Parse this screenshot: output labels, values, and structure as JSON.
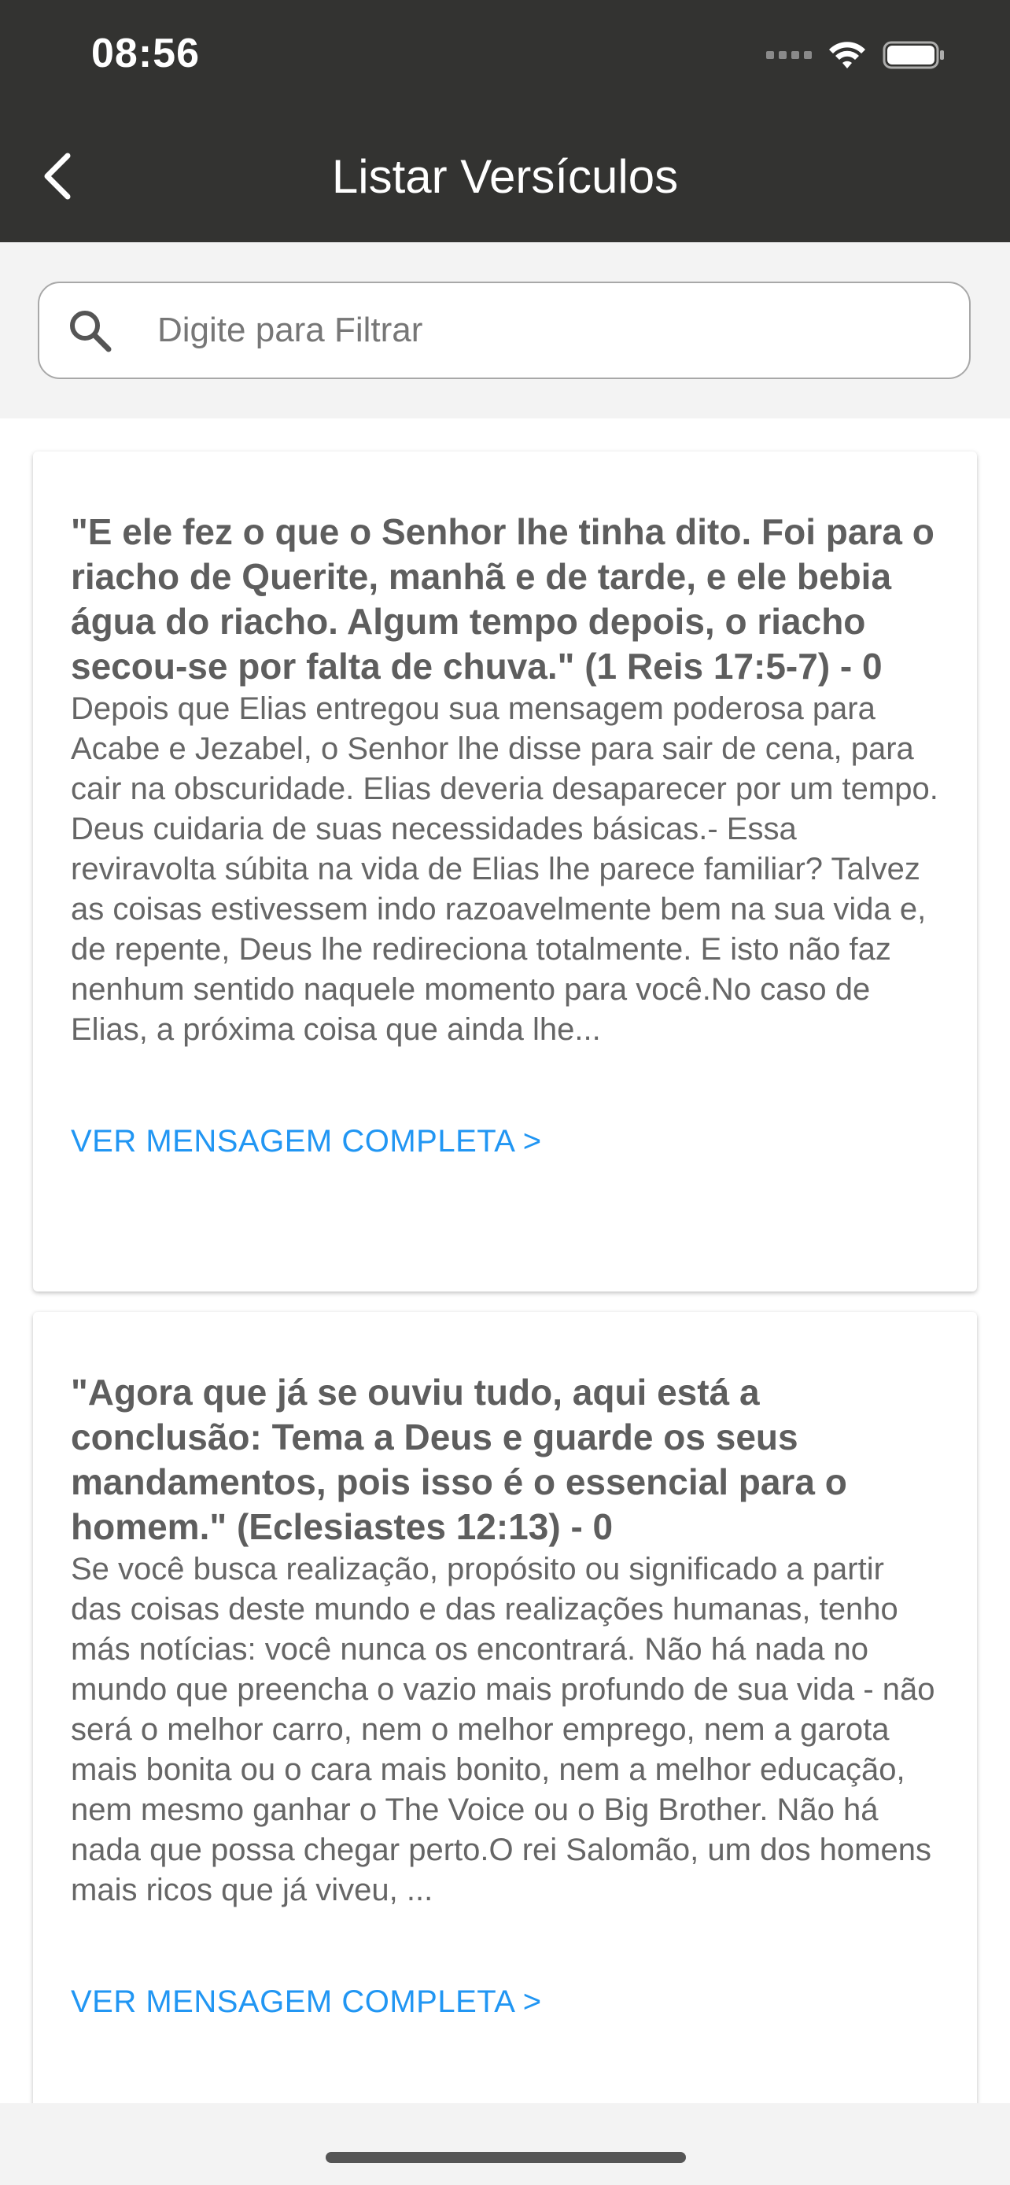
{
  "status_bar": {
    "time": "08:56"
  },
  "header": {
    "title": "Listar Versículos",
    "back_icon": "chevron-left-icon"
  },
  "search": {
    "placeholder": "Digite para Filtrar",
    "value": "",
    "icon": "search-icon"
  },
  "verses": [
    {
      "title": "\"E ele fez o que o Senhor lhe tinha dito. Foi para o riacho de Querite, manhã e de tarde, e ele bebia água do riacho. Algum tempo depois, o riacho secou-se por falta de chuva.\" (1 Reis 17:5-7) - 0",
      "excerpt": "Depois que Elias entregou sua mensagem poderosa para Acabe e Jezabel, o Senhor lhe disse para sair de cena, para cair na obscuridade. Elias deveria desaparecer por um tempo. Deus cuidaria de suas necessidades básicas.- Essa reviravolta súbita na vida de Elias lhe parece familiar? Talvez as coisas estivessem indo razoavelmente bem na sua vida e, de repente, Deus lhe redireciona totalmente. E isto não faz nenhum sentido naquele momento para você.No caso de Elias, a próxima coisa que ainda lhe...",
      "link_label": "VER MENSAGEM COMPLETA >"
    },
    {
      "title": "\"Agora que já se ouviu tudo, aqui está a conclusão: Tema a Deus e guarde os seus mandamentos, pois isso é o essencial para o homem.\" (Eclesiastes 12:13) - 0",
      "excerpt": "Se você busca realização, propósito ou significado a partir das coisas deste mundo e das realizações humanas, tenho más notícias: você nunca os encontrará. Não há nada no mundo que preencha o vazio mais profundo de sua vida - não será o melhor carro, nem o melhor emprego, nem a garota mais bonita ou o cara mais bonito, nem a melhor educação, nem mesmo ganhar o The Voice ou o Big Brother. Não há nada que possa chegar perto.O rei Salomão, um dos homens mais ricos que já viveu, ...",
      "link_label": "VER MENSAGEM COMPLETA >"
    }
  ],
  "colors": {
    "header_bg": "#333331",
    "link": "#2196f3",
    "title_text": "#5e5e5e",
    "body_text": "#666666"
  }
}
